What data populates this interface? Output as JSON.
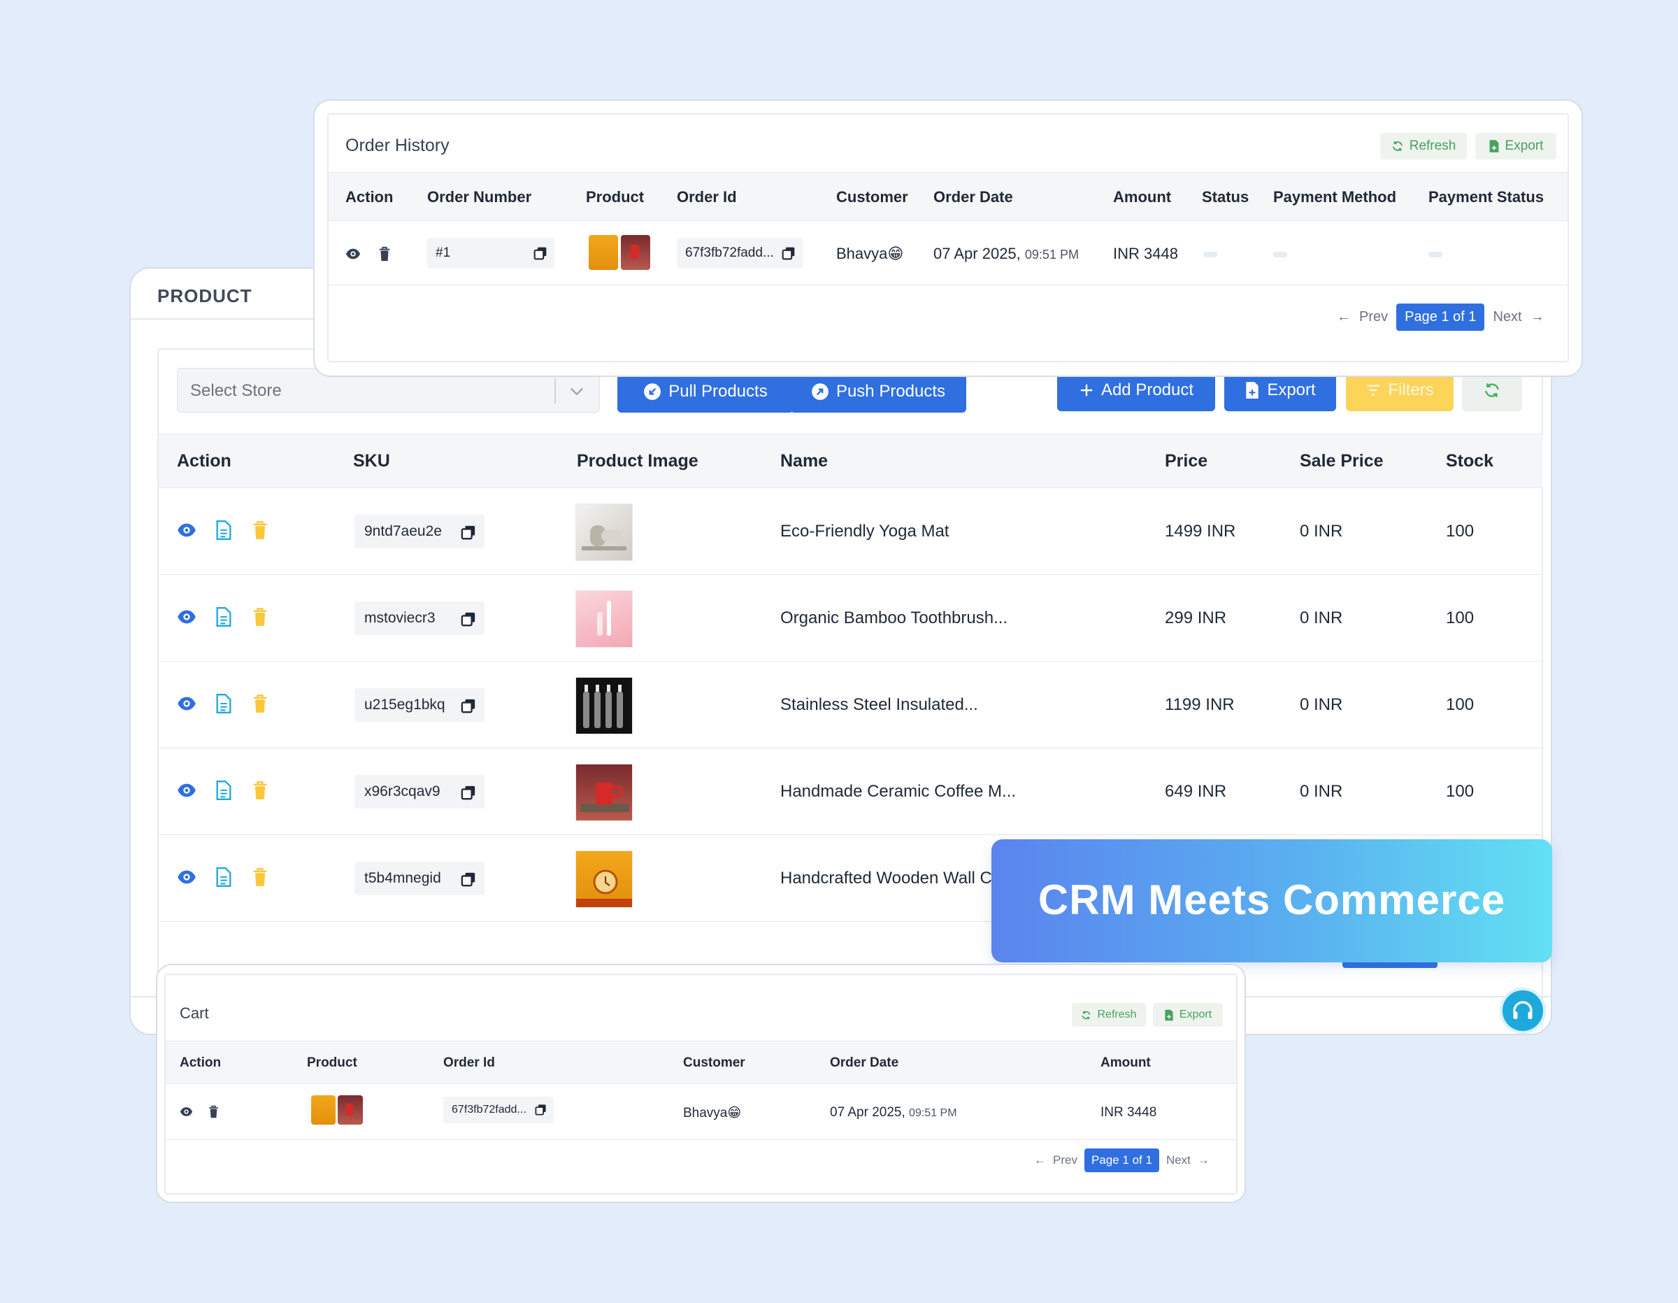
{
  "product": {
    "title": "PRODUCT",
    "store_placeholder": "Select Store",
    "buttons": {
      "pull": "Pull Products",
      "push": "Push Products",
      "add": "Add Product",
      "export": "Export",
      "filters": "Filters"
    },
    "columns": [
      "Action",
      "SKU",
      "Product Image",
      "Name",
      "Price",
      "Sale Price",
      "Stock"
    ],
    "rows": [
      {
        "sku": "9ntd7aeu2e",
        "name": "Eco-Friendly Yoga Mat",
        "price": "1499 INR",
        "sale_price": "0 INR",
        "stock": "100"
      },
      {
        "sku": "mstoviecr3",
        "name": "Organic Bamboo Toothbrush...",
        "price": "299 INR",
        "sale_price": "0 INR",
        "stock": "100"
      },
      {
        "sku": "u215eg1bkq",
        "name": "Stainless Steel Insulated...",
        "price": "1199 INR",
        "sale_price": "0 INR",
        "stock": "100"
      },
      {
        "sku": "x96r3cqav9",
        "name": "Handmade Ceramic Coffee M...",
        "price": "649 INR",
        "sale_price": "0 INR",
        "stock": "100"
      },
      {
        "sku": "t5b4mnegid",
        "name": "Handcrafted Wooden Wall C",
        "price": "",
        "sale_price": "",
        "stock": ""
      }
    ]
  },
  "order_history": {
    "title": "Order History",
    "refresh": "Refresh",
    "export": "Export",
    "columns": [
      "Action",
      "Order Number",
      "Product",
      "Order Id",
      "Customer",
      "Order Date",
      "Amount",
      "Status",
      "Payment Method",
      "Payment Status"
    ],
    "row": {
      "order_number": "#1",
      "order_id": "67f3fb72fadd...",
      "customer": "Bhavya😁",
      "order_date": "07 Apr 2025,",
      "order_time": "09:51 PM",
      "amount": "INR 3448"
    },
    "pager": {
      "prev": "Prev",
      "current": "Page 1 of 1",
      "next": "Next"
    }
  },
  "cart": {
    "title": "Cart",
    "refresh": "Refresh",
    "export": "Export",
    "columns": [
      "Action",
      "Product",
      "Order Id",
      "Customer",
      "Order Date",
      "Amount"
    ],
    "row": {
      "order_id": "67f3fb72fadd...",
      "customer": "Bhavya😁",
      "order_date": "07 Apr 2025,",
      "order_time": "09:51 PM",
      "amount": "INR 3448"
    },
    "pager": {
      "prev": "Prev",
      "current": "Page 1 of 1",
      "next": "Next"
    }
  },
  "banner": {
    "text": "CRM Meets Commerce"
  },
  "colors": {
    "primary": "#2f6fe0",
    "warning": "#fcd45a",
    "success": "#39b15e",
    "background": "#e3ecfa"
  }
}
